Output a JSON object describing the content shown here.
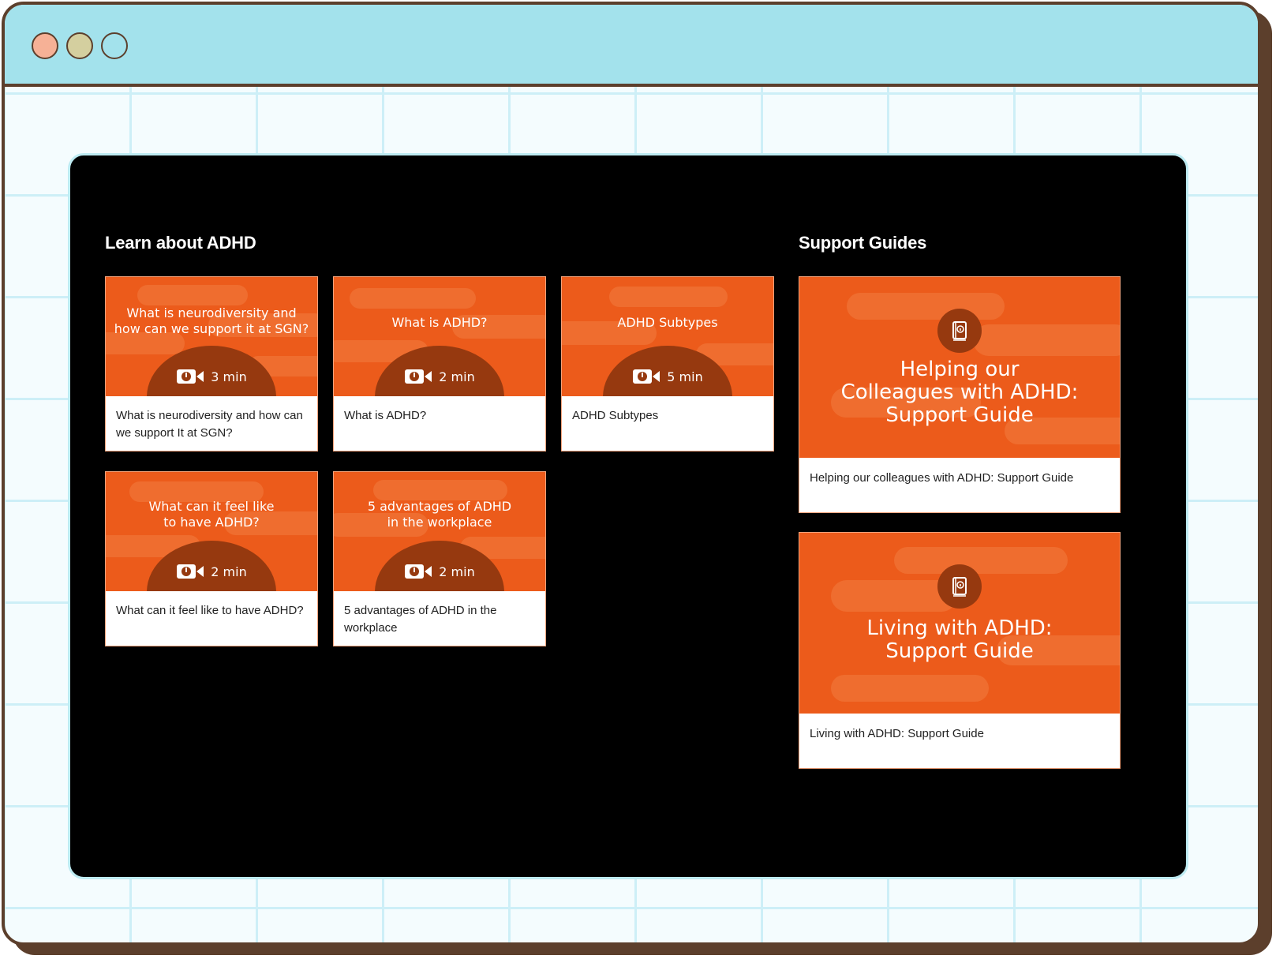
{
  "window": {
    "controls": [
      "close",
      "minimize",
      "maximize"
    ]
  },
  "learn": {
    "heading": "Learn about ADHD",
    "videos": [
      {
        "thumb_line1": "What is neurodiversity and",
        "thumb_line2": "how can we support it at SGN?",
        "duration": "3 min",
        "label": "What is neurodiversity and how can we support It at SGN?"
      },
      {
        "thumb_line1": "What is ADHD?",
        "thumb_line2": "",
        "duration": "2 min",
        "label": "What is ADHD?"
      },
      {
        "thumb_line1": "ADHD Subtypes",
        "thumb_line2": "",
        "duration": "5 min",
        "label": "ADHD Subtypes"
      },
      {
        "thumb_line1": "What can it feel like",
        "thumb_line2": "to have ADHD?",
        "duration": "2 min",
        "label": "What can it feel like to have ADHD?"
      },
      {
        "thumb_line1": "5 advantages of ADHD",
        "thumb_line2": "in the workplace",
        "duration": "2 min",
        "label": "5 advantages of ADHD in the workplace"
      }
    ]
  },
  "guides": {
    "heading": "Support Guides",
    "items": [
      {
        "thumb_line1": "Helping our",
        "thumb_line2": "Colleagues with ADHD:",
        "thumb_line3": "Support Guide",
        "label": "Helping our colleagues with ADHD: Support Guide"
      },
      {
        "thumb_line1": "Living with ADHD:",
        "thumb_line2": "Support Guide",
        "thumb_line3": "",
        "label": "Living with ADHD: Support Guide"
      }
    ]
  },
  "colors": {
    "titlebar": "#a3e2ec",
    "frame": "#5c3f2c",
    "card_orange": "#ec5b1b",
    "dome_brown": "#96390f",
    "panel": "#000000"
  },
  "icons": [
    "video-camera-icon",
    "book-icon"
  ]
}
